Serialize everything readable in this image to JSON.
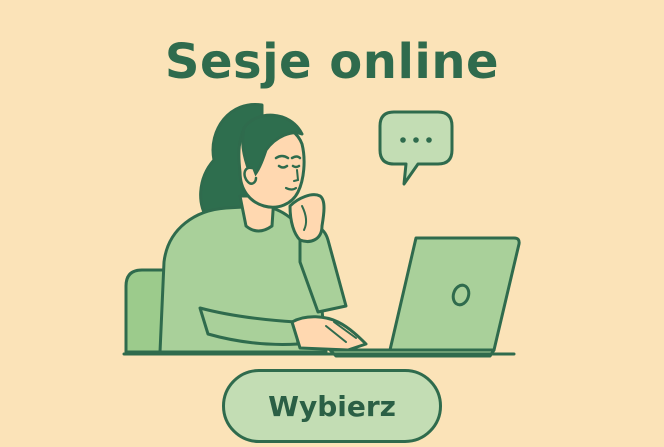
{
  "card": {
    "title": "Sesje online",
    "button_label": "Wybierz"
  },
  "icons": {
    "chat": "chat-bubble-icon"
  },
  "colors": {
    "background": "#FBE3B8",
    "primary": "#2F6B4D",
    "accent_green": "#9CCB8C",
    "button_fill": "#C3DDB4"
  }
}
